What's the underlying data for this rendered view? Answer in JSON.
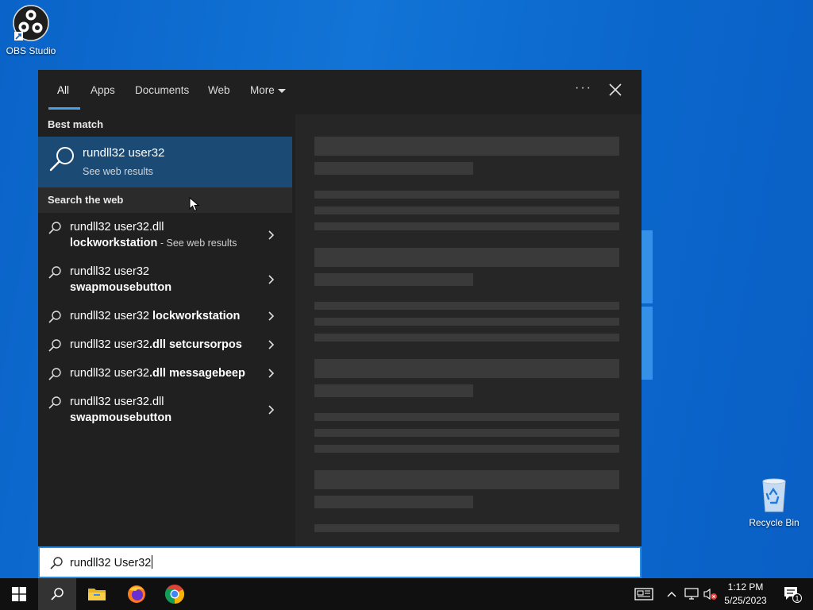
{
  "desktop": {
    "icons": [
      {
        "label": "OBS Studio"
      },
      {
        "label": "Recycle Bin"
      }
    ]
  },
  "search_panel": {
    "tabs": [
      {
        "label": "All",
        "active": true
      },
      {
        "label": "Apps"
      },
      {
        "label": "Documents"
      },
      {
        "label": "Web"
      },
      {
        "label": "More"
      }
    ],
    "options_icon": "more-options-icon",
    "close_icon": "close-icon",
    "best_match": {
      "section_label": "Best match",
      "title": "rundll32 user32",
      "subtitle": "See web results"
    },
    "search_web": {
      "section_label": "Search the web",
      "suggestions": [
        {
          "prefix": "rundll32 user32.dll",
          "bold": "lockworkstation",
          "suffix": " - See web results"
        },
        {
          "prefix": "rundll32 user32",
          "bold": "swapmousebutton",
          "suffix": ""
        },
        {
          "prefix": "rundll32 user32 ",
          "bold": "lockworkstation",
          "suffix": ""
        },
        {
          "prefix": "rundll32 user32",
          "bold": ".dll setcursorpos",
          "suffix": ""
        },
        {
          "prefix": "rundll32 user32",
          "bold": ".dll messagebeep",
          "suffix": ""
        },
        {
          "prefix": "rundll32 user32.dll",
          "bold": "swapmousebutton",
          "suffix": ""
        }
      ]
    }
  },
  "search_box": {
    "value": "rundll32 User32"
  },
  "taskbar": {
    "apps": [
      "windows-start-icon",
      "search-icon",
      "file-explorer-icon",
      "firefox-icon",
      "chrome-icon"
    ],
    "tray": [
      "news-icon",
      "chevron-up-icon",
      "network-icon",
      "volume-muted-icon"
    ],
    "time": "1:12 PM",
    "date": "5/25/2023",
    "notification_count": "1"
  },
  "colors": {
    "accent": "#2b8de0",
    "best_match_bg": "#1b4a74",
    "panel_bg": "#202020"
  }
}
